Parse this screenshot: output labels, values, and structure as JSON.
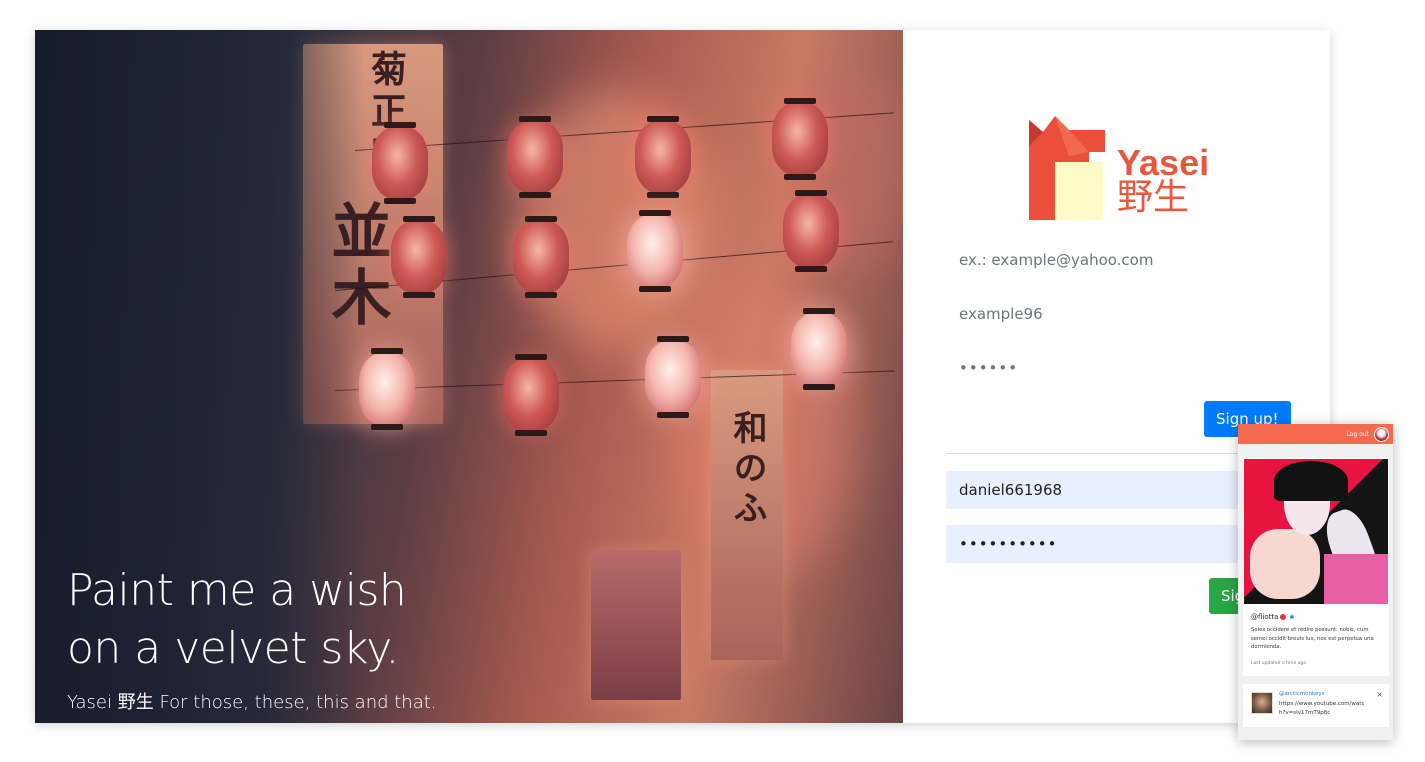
{
  "hero": {
    "title_line1": "Paint me a wish",
    "title_line2": "on a velvet sky.",
    "subtitle": "Yasei 野生 For those, these, this and that."
  },
  "brand": {
    "name": "Yasei",
    "kanji": "野生",
    "color": "#e9573f"
  },
  "signup": {
    "email_placeholder": "ex.: example@yahoo.com",
    "username_placeholder": "example96",
    "password_mask": "••••••",
    "button_label": "Sign up!"
  },
  "signin": {
    "username_value": "daniel661968",
    "password_mask": "••••••••••",
    "button_label": "Sign in"
  },
  "colors": {
    "sign_up_button": "#007bff",
    "sign_in_button": "#28a745",
    "autofill_background": "#e8f0fe",
    "phone_header": "#f46a4e"
  },
  "phone_preview": {
    "logout_label": "Log out",
    "post": {
      "handle": "@fliotta",
      "text": "Soles occidere et redire possunt: nobis, cum semel occidit breuis lux, nox est perpetua una dormienda.",
      "updated": "Last updated a time ago"
    },
    "reply": {
      "user": "@arcticmonkeys",
      "text": "https://www.youtube.com/watch?v=sIv17mT9p8c",
      "close_symbol": "×"
    }
  }
}
